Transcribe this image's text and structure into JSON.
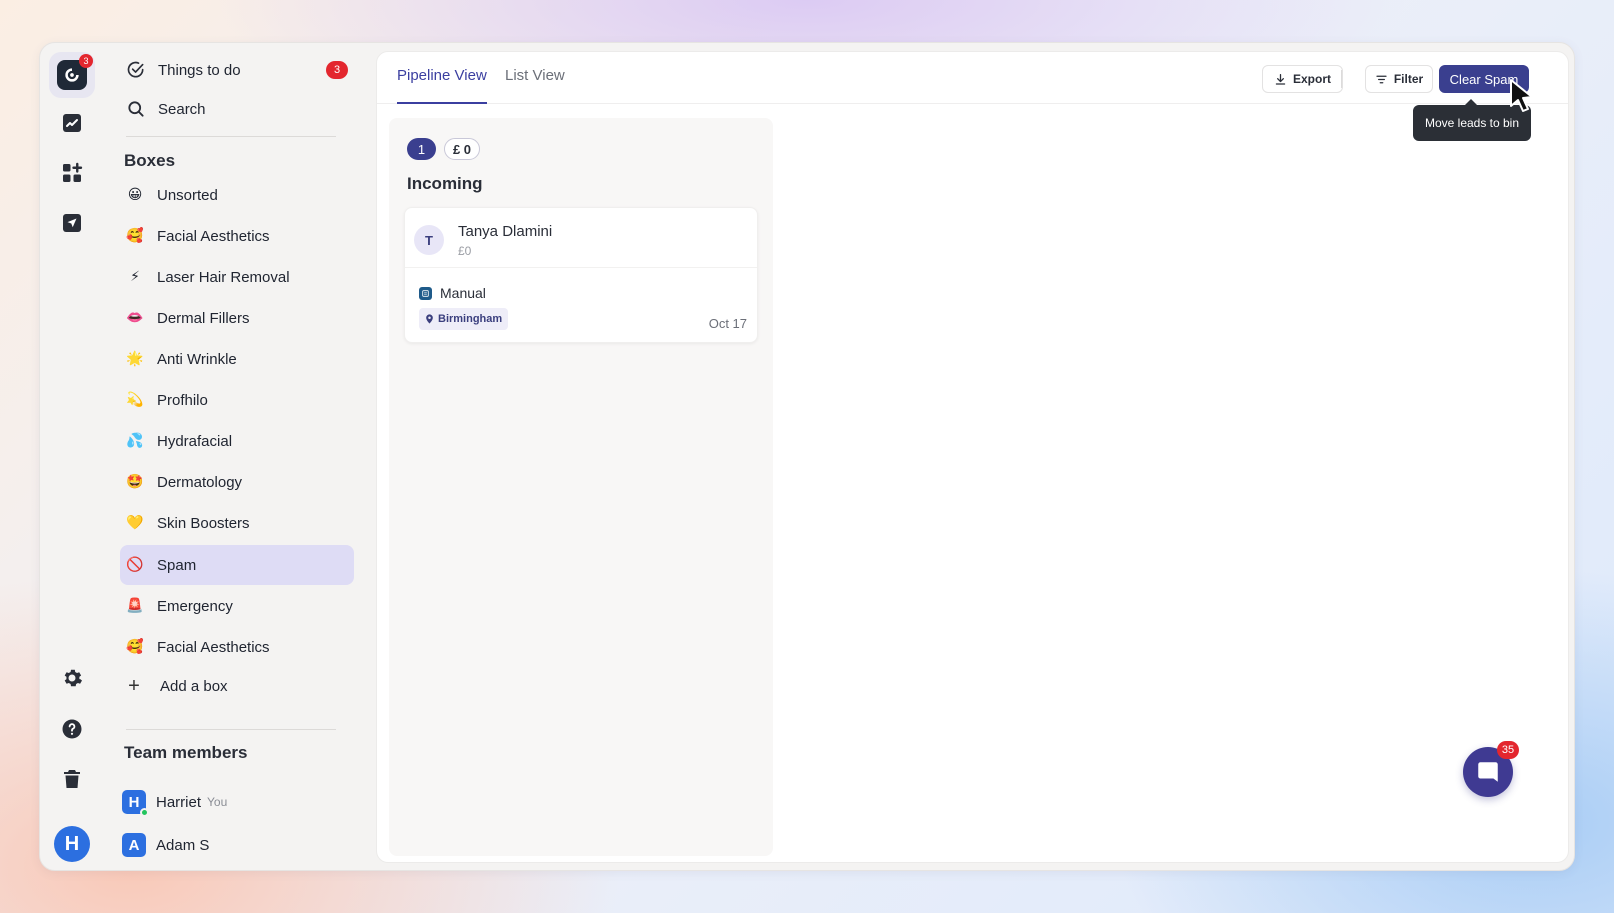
{
  "rail": {
    "logo_badge": "3"
  },
  "sidebar": {
    "todo_label": "Things to do",
    "todo_count": "3",
    "search_label": "Search",
    "boxes_title": "Boxes",
    "boxes": [
      {
        "emoji": "😀",
        "label": "Unsorted"
      },
      {
        "emoji": "🥰",
        "label": "Facial Aesthetics"
      },
      {
        "emoji": "⚡",
        "label": "Laser Hair Removal"
      },
      {
        "emoji": "👄",
        "label": "Dermal Fillers"
      },
      {
        "emoji": "🌟",
        "label": "Anti Wrinkle"
      },
      {
        "emoji": "💫",
        "label": "Profhilo"
      },
      {
        "emoji": "💦",
        "label": "Hydrafacial"
      },
      {
        "emoji": "🤩",
        "label": "Dermatology"
      },
      {
        "emoji": "💛",
        "label": "Skin Boosters"
      },
      {
        "emoji": "🚫",
        "label": "Spam"
      },
      {
        "emoji": "🚨",
        "label": "Emergency"
      },
      {
        "emoji": "🥰",
        "label": "Facial Aesthetics"
      }
    ],
    "active_box": "Spam",
    "add_box_label": "Add a box",
    "team_title": "Team members",
    "members": [
      {
        "initial": "H",
        "name": "Harriet",
        "tag": "You"
      },
      {
        "initial": "A",
        "name": "Adam S",
        "tag": ""
      }
    ],
    "user_initial": "H"
  },
  "main": {
    "tabs": [
      {
        "label": "Pipeline View",
        "active": true
      },
      {
        "label": "List View",
        "active": false
      }
    ],
    "export_label": "Export",
    "filter_label": "Filter",
    "clear_spam_label": "Clear Spam",
    "tooltip": "Move leads to bin",
    "column": {
      "count": "1",
      "amount": "£ 0",
      "title": "Incoming",
      "cards": [
        {
          "initial": "T",
          "name": "Tanya Dlamini",
          "value": "£0",
          "source": "Manual",
          "location": "Birmingham",
          "date": "Oct 17"
        }
      ]
    }
  },
  "chat": {
    "badge": "35"
  },
  "colors": {
    "accent": "#3a3f8f",
    "badge_red": "#e3262e",
    "active_bg": "#dedcf5",
    "avatar_blue": "#2c6fe0"
  }
}
